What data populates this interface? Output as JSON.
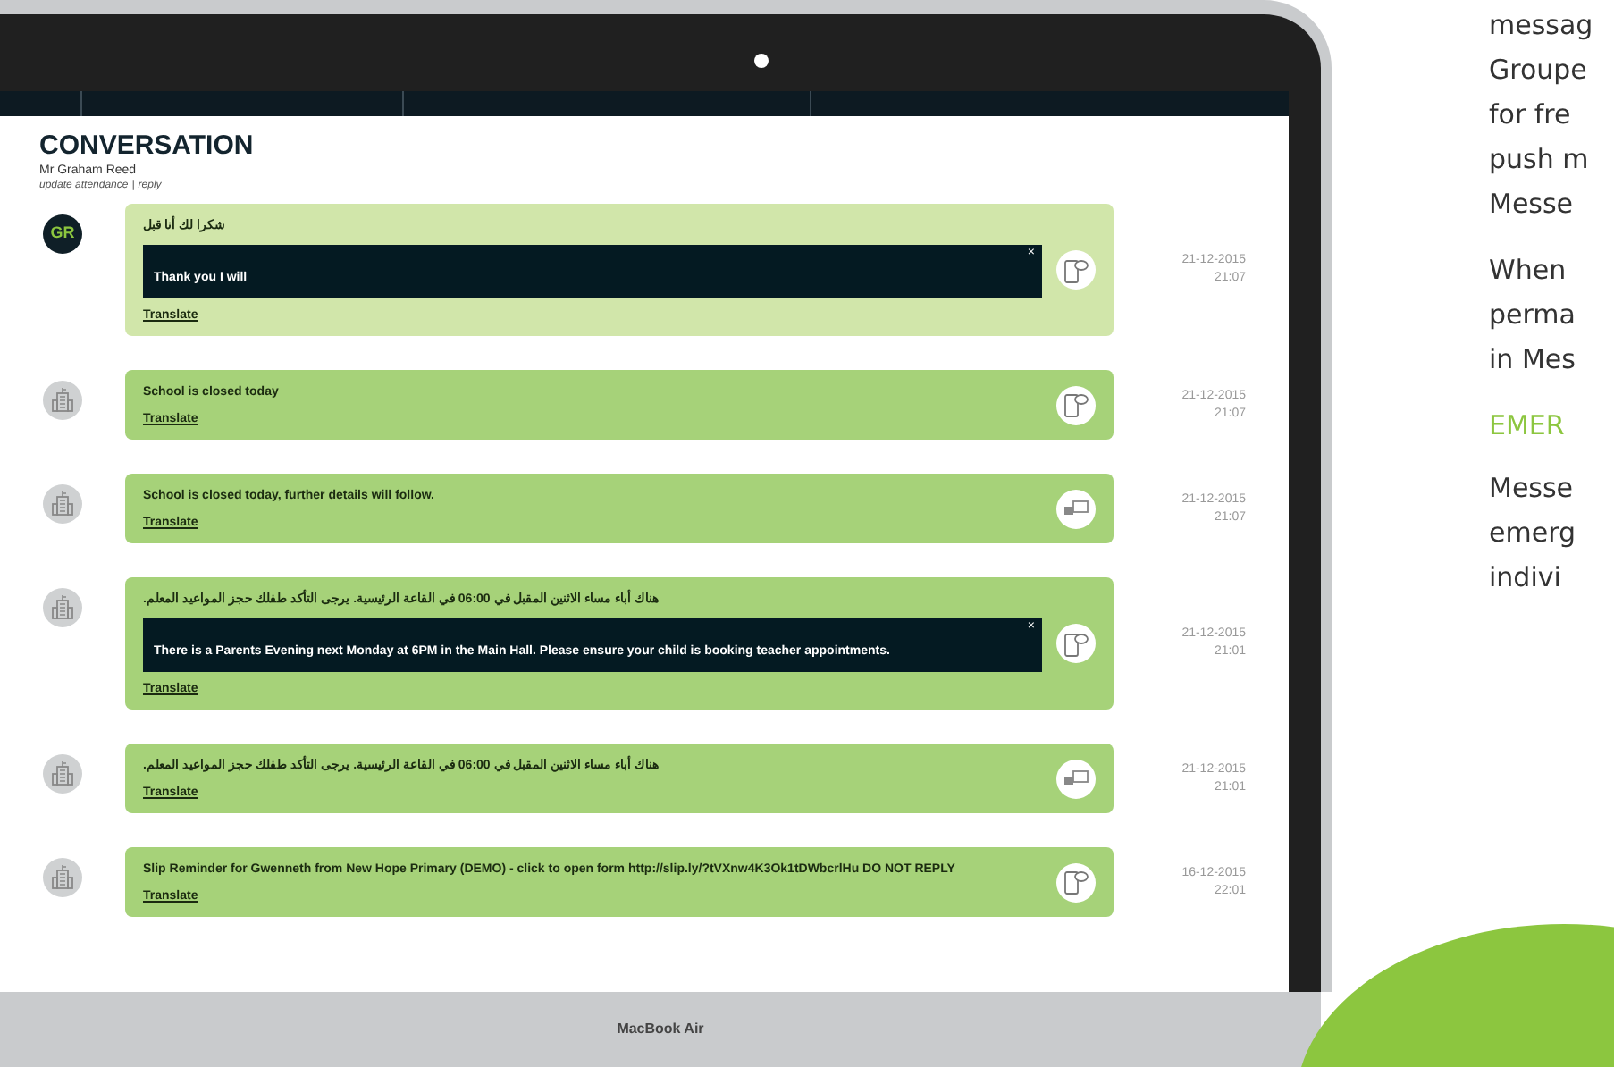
{
  "conversation": {
    "title": "CONVERSATION",
    "contact": "Mr Graham Reed",
    "actions": [
      {
        "label": "update attendance"
      },
      {
        "label": "reply"
      }
    ],
    "separator": "|"
  },
  "messages": [
    {
      "kind": "reply",
      "avatar": {
        "kind": "initials",
        "text": "GR"
      },
      "text": "شكرا لك أنا قبل",
      "translation": "Thank you I will",
      "close": "×",
      "link": "Translate",
      "channel": {
        "kind": "app"
      },
      "date": "21-12-2015",
      "time": "21:07"
    },
    {
      "kind": "sent",
      "avatar": {
        "kind": "school"
      },
      "text": "School is closed today",
      "link": "Translate",
      "channel": {
        "kind": "app"
      },
      "date": "21-12-2015",
      "time": "21:07"
    },
    {
      "kind": "sent",
      "avatar": {
        "kind": "school"
      },
      "text": "School is closed today, further details will follow.",
      "link": "Translate",
      "channel": {
        "kind": "sms"
      },
      "date": "21-12-2015",
      "time": "21:07"
    },
    {
      "kind": "sent",
      "avatar": {
        "kind": "school"
      },
      "text": "هناك أباء مساء الاثنين المقبل في **06:00** في القاعة الرئيسية. يرجى التأكد طفلك حجز المواعيد المعلم.",
      "translation": "There is a Parents Evening next Monday at 6PM in the Main Hall. Please ensure your child is booking teacher appointments.",
      "close": "×",
      "link": "Translate",
      "channel": {
        "kind": "app"
      },
      "date": "21-12-2015",
      "time": "21:01"
    },
    {
      "kind": "sent",
      "avatar": {
        "kind": "school"
      },
      "text": "هناك أباء مساء الاثنين المقبل في **06:00** في القاعة الرئيسية. يرجى التأكد طفلك حجز المواعيد المعلم.",
      "link": "Translate",
      "channel": {
        "kind": "sms"
      },
      "date": "21-12-2015",
      "time": "21:01"
    },
    {
      "kind": "sent",
      "avatar": {
        "kind": "school"
      },
      "text": "Slip Reminder for Gwenneth from New Hope Primary (DEMO) - click to open form http://slip.ly/?tVXnw4K3Ok1tDWbcrlHu DO NOT REPLY",
      "link": "Translate",
      "channel": {
        "kind": "app"
      },
      "date": "16-12-2015",
      "time": "22:01"
    }
  ],
  "laptop_label": "MacBook Air",
  "side_text": {
    "paragraphs": [
      [
        "messag",
        "Groupe",
        "for fre",
        "push m",
        "Messe"
      ],
      [
        "When",
        "perma",
        "in Mes"
      ]
    ],
    "heading": "EMER",
    "after": [
      [
        "Messe",
        "emerg",
        "indivi"
      ]
    ]
  }
}
